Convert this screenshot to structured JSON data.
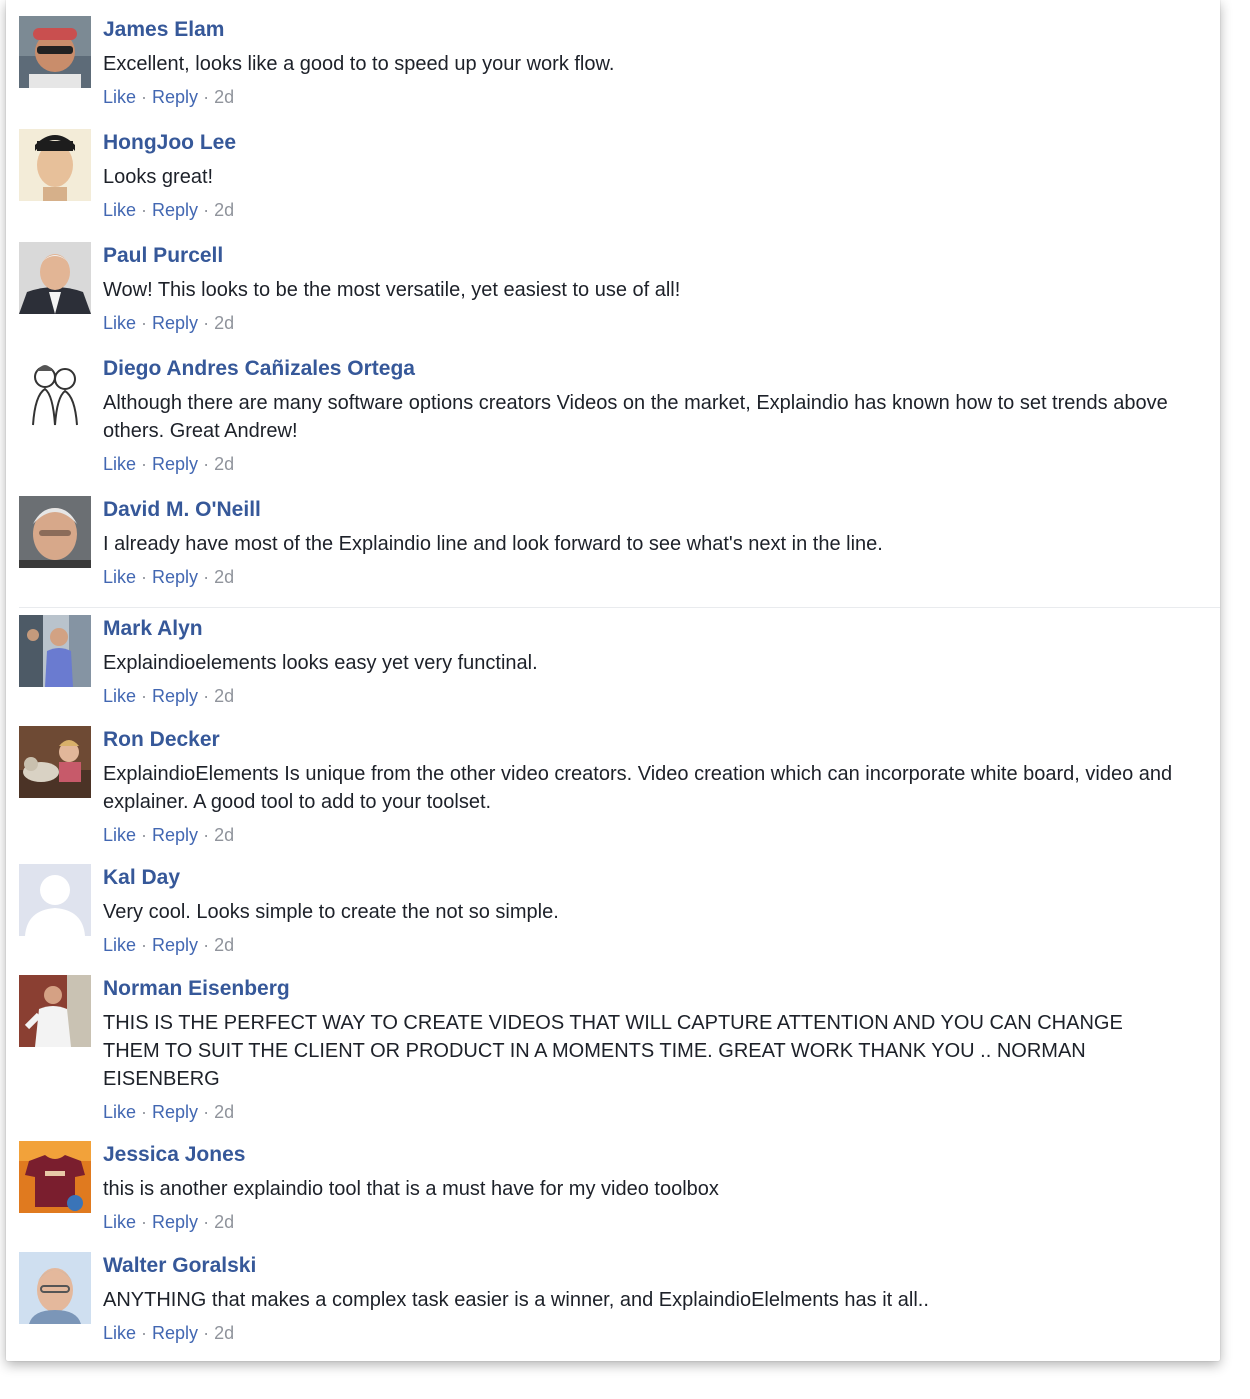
{
  "comments": [
    {
      "author": "James Elam",
      "text": "Excellent, looks like a good to to speed up your work flow.",
      "like": "Like",
      "reply": "Reply",
      "time": "2d",
      "avatar_icon": "avatar-photo"
    },
    {
      "author": "HongJoo Lee",
      "text": "Looks great!",
      "like": "Like",
      "reply": "Reply",
      "time": "2d",
      "avatar_icon": "avatar-photo"
    },
    {
      "author": "Paul Purcell",
      "text": "Wow! This looks to be the most versatile, yet easiest to use of all!",
      "like": "Like",
      "reply": "Reply",
      "time": "2d",
      "avatar_icon": "avatar-photo"
    },
    {
      "author": "Diego Andres Cañizales Ortega",
      "text": "Although there are many software options creators Videos on the market, Explaindio has known how to set trends above others. Great Andrew!",
      "like": "Like",
      "reply": "Reply",
      "time": "2d",
      "avatar_icon": "avatar-sketch"
    },
    {
      "author": "David M. O'Neill",
      "text": "I already have most of the Explaindio line and look forward to see what's next in the line.",
      "like": "Like",
      "reply": "Reply",
      "time": "2d",
      "avatar_icon": "avatar-photo"
    },
    {
      "author": "Mark Alyn",
      "text": "Explaindioelements looks easy yet very functinal.",
      "like": "Like",
      "reply": "Reply",
      "time": "2d",
      "avatar_icon": "avatar-photo"
    },
    {
      "author": "Ron Decker",
      "text": "ExplaindioElements Is unique from the other video creators. Video creation which can incorporate white board, video and explainer. A good tool to add to your toolset.",
      "like": "Like",
      "reply": "Reply",
      "time": "2d",
      "avatar_icon": "avatar-photo"
    },
    {
      "author": "Kal Day",
      "text": "Very cool. Looks simple to create the not so simple.",
      "like": "Like",
      "reply": "Reply",
      "time": "2d",
      "avatar_icon": "default-avatar-silhouette"
    },
    {
      "author": "Norman Eisenberg",
      "text": "THIS IS THE PERFECT WAY TO CREATE VIDEOS THAT WILL CAPTURE ATTENTION AND YOU CAN CHANGE THEM TO SUIT THE CLIENT OR PRODUCT IN A MOMENTS TIME. GREAT WORK THANK YOU .. NORMAN EISENBERG",
      "like": "Like",
      "reply": "Reply",
      "time": "2d",
      "avatar_icon": "avatar-photo"
    },
    {
      "author": "Jessica Jones",
      "text": "this is another explaindio tool that is a must have for my video toolbox",
      "like": "Like",
      "reply": "Reply",
      "time": "2d",
      "avatar_icon": "avatar-photo"
    },
    {
      "author": "Walter Goralski",
      "text": "ANYTHING that makes a complex task easier is a winner, and ExplaindioElelments has it all..",
      "like": "Like",
      "reply": "Reply",
      "time": "2d",
      "avatar_icon": "avatar-photo"
    }
  ],
  "colors": {
    "author": "#365899",
    "link": "#4267b2",
    "meta": "#90949c",
    "text": "#1d2129"
  }
}
